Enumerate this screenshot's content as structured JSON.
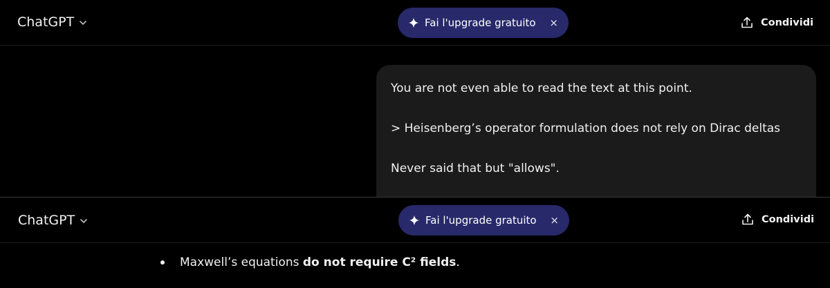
{
  "colors": {
    "background": "#000000",
    "upgrade_pill": "#27296a",
    "message_bubble": "#1a1b1a",
    "text": "#f1f1f1"
  },
  "header_top": {
    "brand": "ChatGPT",
    "upgrade_label": "Fai l'upgrade gratuito",
    "close_label": "×",
    "share_label": "Condividi"
  },
  "user_message": {
    "line1": "You are not even able to read the text at this point.",
    "line2": "> Heisenberg’s operator formulation does not rely on Dirac deltas",
    "line3": "Never said that but \"allows\"."
  },
  "header_bottom": {
    "brand": "ChatGPT",
    "upgrade_label": "Fai l'upgrade gratuito",
    "close_label": "×",
    "share_label": "Condividi"
  },
  "assistant_message": {
    "bullet_prefix": "Maxwell’s equations ",
    "bullet_bold": "do not require C² fields",
    "bullet_suffix": "."
  },
  "icons": {
    "brand_dropdown": "chevron-down-icon",
    "upgrade": "sparkle-icon",
    "share": "share-upload-icon"
  }
}
